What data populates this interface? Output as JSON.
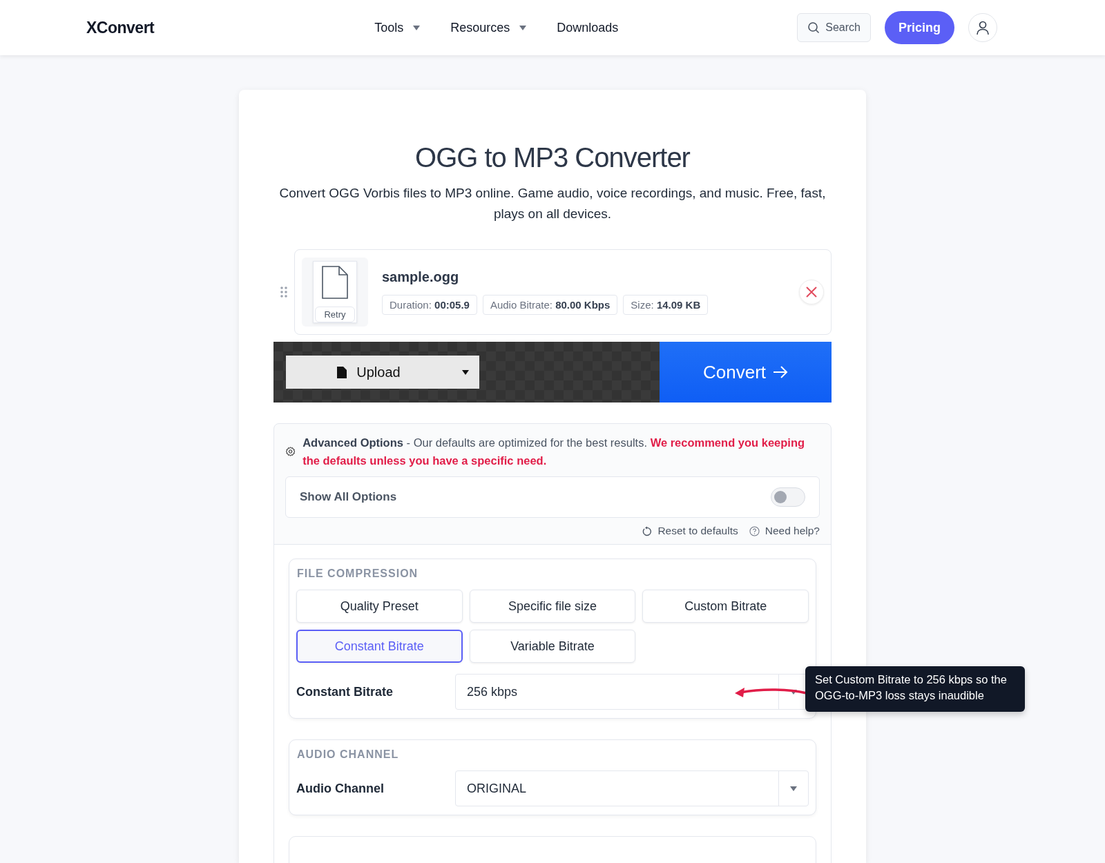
{
  "header": {
    "logo": "XConvert",
    "nav": [
      {
        "label": "Tools",
        "dropdown": true
      },
      {
        "label": "Resources",
        "dropdown": true
      },
      {
        "label": "Downloads",
        "dropdown": false
      }
    ],
    "search": {
      "placeholder": "Search"
    },
    "pricing": "Pricing"
  },
  "title": "OGG to MP3 Converter",
  "subtitle": "Convert OGG Vorbis files to MP3 online. Game audio, voice recordings, and music. Free, fast, plays on all devices.",
  "file": {
    "name": "sample.ogg",
    "retry": "Retry",
    "meta": [
      {
        "label": "Duration:",
        "value": "00:05.9"
      },
      {
        "label": "Audio Bitrate:",
        "value": "80.00 Kbps"
      },
      {
        "label": "Size:",
        "value": "14.09 KB"
      }
    ]
  },
  "upload": "Upload",
  "convert": "Convert",
  "advanced": {
    "intro": "**Advanced Options** - Our defaults are optimized for the best results.",
    "warning": "We recommend you keeping the defaults unless you have a specific need.",
    "toggle": {
      "label": "Show All Options",
      "on": false
    },
    "reset": "Reset to defaults",
    "help": "Need help?"
  },
  "sections": [
    {
      "heading": "FILE COMPRESSION",
      "options": [
        {
          "label": "Quality Preset",
          "selected": false
        },
        {
          "label": "Specific file size",
          "selected": false
        },
        {
          "label": "Custom Bitrate",
          "selected": false
        },
        {
          "label": "Constant Bitrate",
          "selected": true
        },
        {
          "label": "Variable Bitrate",
          "selected": false
        }
      ],
      "field": {
        "label": "Constant Bitrate",
        "value": "256 kbps"
      }
    },
    {
      "heading": "AUDIO CHANNEL",
      "field": {
        "label": "Audio Channel",
        "value": "ORIGINAL"
      }
    }
  ],
  "tooltip": "Set Custom Bitrate to 256 kbps so the OGG-to-MP3 loss stays inaudible"
}
